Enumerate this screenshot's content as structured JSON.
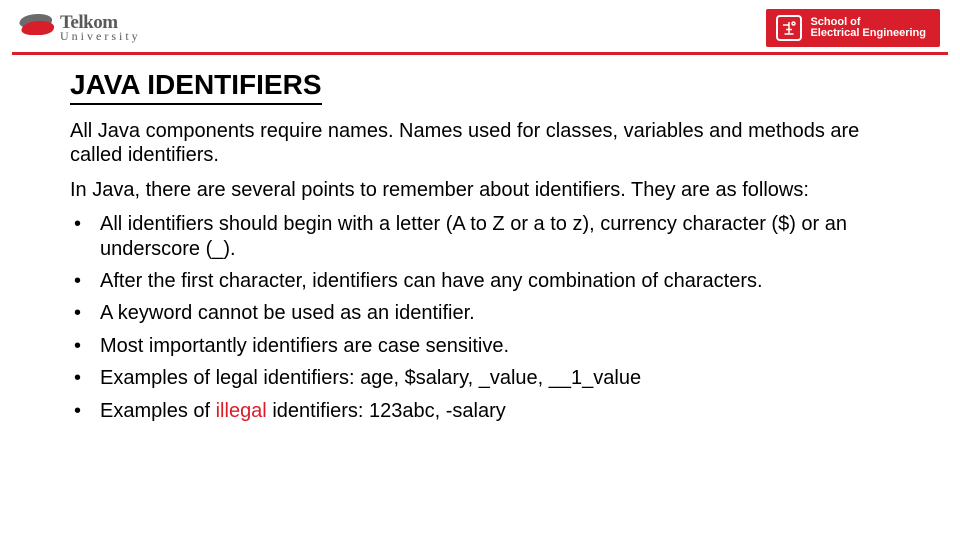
{
  "header": {
    "left_logo": {
      "line1": "Telkom",
      "line2": "University",
      "icon": "telkom-wing-icon"
    },
    "right_logo": {
      "line1": "School of",
      "line2": "Electrical Engineering",
      "icon": "circuit-icon"
    }
  },
  "slide": {
    "title": "JAVA IDENTIFIERS",
    "para1": "All Java components require names. Names used for classes, variables and methods are called identifiers.",
    "para2": "In Java, there are several points to remember about identifiers. They are as follows:",
    "bullets": [
      "All identifiers should begin with a letter (A to Z or a to z), currency character ($) or an underscore (_).",
      "After the first character, identifiers can have any combination of characters.",
      "A keyword cannot be used as an identifier.",
      "Most importantly identifiers are case sensitive.",
      "Examples of legal identifiers: age, $salary, _value, __1_value"
    ],
    "bullet_illegal": {
      "prefix": "Examples of ",
      "illegal_word": "illegal",
      "suffix": " identifiers: 123abc, -salary"
    }
  }
}
